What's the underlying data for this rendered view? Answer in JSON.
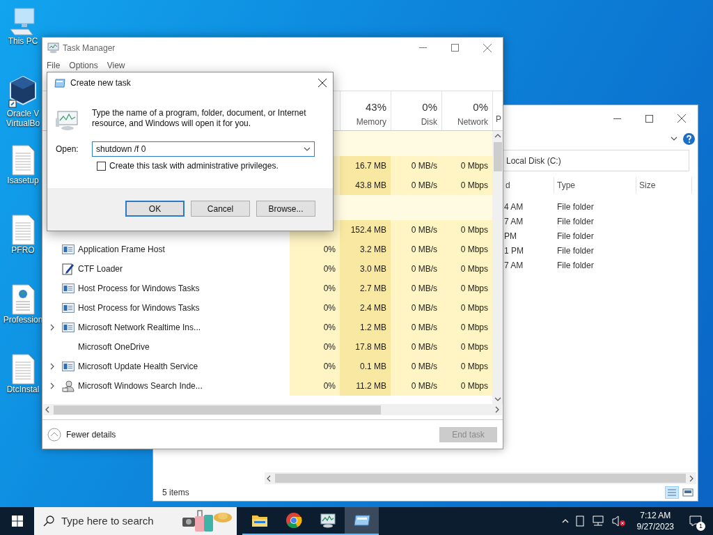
{
  "desktop_icons": [
    {
      "kind": "computer",
      "lines": [
        "This PC"
      ]
    },
    {
      "kind": "virtualbox",
      "lines": [
        "Oracle V",
        "VirtualBo"
      ]
    },
    {
      "kind": "document",
      "lines": [
        "Isasetup"
      ]
    },
    {
      "kind": "document",
      "lines": [
        "PFRO"
      ]
    },
    {
      "kind": "web-document",
      "lines": [
        "Profession"
      ]
    },
    {
      "kind": "document",
      "lines": [
        "DtcInstal"
      ]
    }
  ],
  "explorer": {
    "address": "Local Disk (C:)",
    "columns": [
      "d",
      "Type",
      "Size"
    ],
    "rows": [
      {
        "date": "4 AM",
        "type": "File folder"
      },
      {
        "date": "7 AM",
        "type": "File folder"
      },
      {
        "date": "PM",
        "type": "File folder"
      },
      {
        "date": "1 PM",
        "type": "File folder"
      },
      {
        "date": "7 AM",
        "type": "File folder"
      }
    ],
    "status": "5 items"
  },
  "task_manager": {
    "title": "Task Manager",
    "menu": [
      "File",
      "Options",
      "View"
    ],
    "columns": [
      {
        "percent": "43%",
        "label": "Memory"
      },
      {
        "percent": "0%",
        "label": "Disk"
      },
      {
        "percent": "0%",
        "label": "Network"
      },
      {
        "label": "P"
      }
    ],
    "rows": [
      {
        "kind": "group"
      },
      {
        "kind": "hidden",
        "memory": "16.7 MB",
        "disk": "0 MB/s",
        "network": "0 Mbps"
      },
      {
        "kind": "hidden",
        "memory": "43.8 MB",
        "disk": "0 MB/s",
        "network": "0 Mbps"
      },
      {
        "kind": "group"
      },
      {
        "kind": "hidden",
        "memory": "152.4 MB",
        "disk": "0 MB/s",
        "network": "0 Mbps"
      },
      {
        "kind": "app",
        "expandable": false,
        "name": "Application Frame Host",
        "cpu": "0%",
        "memory": "3.2 MB",
        "disk": "0 MB/s",
        "network": "0 Mbps"
      },
      {
        "kind": "pen",
        "expandable": false,
        "name": "CTF Loader",
        "cpu": "0%",
        "memory": "3.0 MB",
        "disk": "0 MB/s",
        "network": "0 Mbps"
      },
      {
        "kind": "app",
        "expandable": false,
        "name": "Host Process for Windows Tasks",
        "cpu": "0%",
        "memory": "2.7 MB",
        "disk": "0 MB/s",
        "network": "0 Mbps"
      },
      {
        "kind": "app",
        "expandable": false,
        "name": "Host Process for Windows Tasks",
        "cpu": "0%",
        "memory": "2.4 MB",
        "disk": "0 MB/s",
        "network": "0 Mbps"
      },
      {
        "kind": "app",
        "expandable": true,
        "name": "Microsoft Network Realtime Ins...",
        "cpu": "0%",
        "memory": "1.2 MB",
        "disk": "0 MB/s",
        "network": "0 Mbps"
      },
      {
        "kind": "plain",
        "expandable": false,
        "name": "Microsoft OneDrive",
        "cpu": "0%",
        "memory": "17.8 MB",
        "disk": "0 MB/s",
        "network": "0 Mbps"
      },
      {
        "kind": "app",
        "expandable": true,
        "name": "Microsoft Update Health Service",
        "cpu": "0%",
        "memory": "0.1 MB",
        "disk": "0 MB/s",
        "network": "0 Mbps"
      },
      {
        "kind": "search",
        "expandable": true,
        "name": "Microsoft Windows Search Inde...",
        "cpu": "0%",
        "memory": "11.2 MB",
        "disk": "0 MB/s",
        "network": "0 Mbps"
      }
    ],
    "fewer_details": "Fewer details",
    "end_task": {
      "label": "End task",
      "disabled": true
    }
  },
  "dialog": {
    "title": "Create new task",
    "message": "Type the name of a program, folder, document, or Internet resource, and Windows will open it for you.",
    "open_label": "Open:",
    "open_value": "shutdown /f 0",
    "admin_checkbox": {
      "label": "Create this task with administrative privileges.",
      "checked": false
    },
    "buttons": [
      {
        "label": "OK",
        "default": true
      },
      {
        "label": "Cancel",
        "default": false
      },
      {
        "label": "Browse...",
        "default": false
      }
    ]
  },
  "taskbar": {
    "search_placeholder": "Type here to search",
    "apps": [
      {
        "kind": "explorer",
        "active": false
      },
      {
        "kind": "chrome",
        "active": false
      },
      {
        "kind": "taskmanager",
        "active": false
      },
      {
        "kind": "run",
        "active": true
      }
    ],
    "time": "7:12 AM",
    "date": "9/27/2023",
    "notifications": "1"
  }
}
